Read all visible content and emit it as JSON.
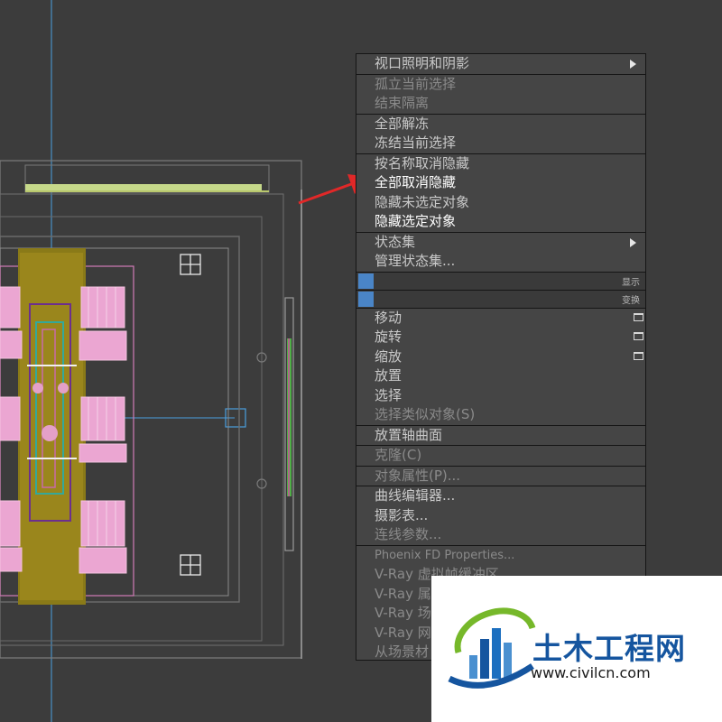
{
  "menu": {
    "sections": [
      [
        {
          "label": "视口照明和阴影",
          "submenu": true
        }
      ],
      [
        {
          "label": "孤立当前选择",
          "dim": true
        },
        {
          "label": "结束隔离",
          "dim": true
        }
      ],
      [
        {
          "label": "全部解冻"
        },
        {
          "label": "冻结当前选择"
        }
      ],
      [
        {
          "label": "按名称取消隐藏"
        },
        {
          "label": "全部取消隐藏",
          "highlight": true
        },
        {
          "label": "隐藏未选定对象"
        },
        {
          "label": "隐藏选定对象",
          "highlight": true
        }
      ],
      [
        {
          "label": "状态集",
          "submenu": true
        },
        {
          "label": "管理状态集..."
        }
      ]
    ],
    "quad_labels": {
      "display": "显示",
      "transform": "变换"
    },
    "transform_items": [
      {
        "label": "移动",
        "options": true
      },
      {
        "label": "旋转",
        "options": true
      },
      {
        "label": "缩放",
        "options": true
      },
      {
        "label": "放置"
      },
      {
        "label": "选择"
      },
      {
        "label": "选择类似对象(S)",
        "dim": true
      }
    ],
    "lower_sections": [
      [
        {
          "label": "放置轴曲面"
        }
      ],
      [
        {
          "label": "克隆(C)",
          "dim": true
        }
      ],
      [
        {
          "label": "对象属性(P)...",
          "dim": true
        }
      ],
      [
        {
          "label": "曲线编辑器..."
        },
        {
          "label": "摄影表..."
        },
        {
          "label": "连线参数...",
          "dim": true
        }
      ],
      [
        {
          "label": "Phoenix FD Properties...",
          "dim": true,
          "en": true
        },
        {
          "label": "V-Ray 虚拟帧缓冲区"
        },
        {
          "label": "V-Ray 属"
        },
        {
          "label": "V-Ray 场"
        },
        {
          "label": "V-Ray 网"
        },
        {
          "label": "从场景材"
        }
      ]
    ]
  },
  "watermark": {
    "brand": "土木工程网",
    "url": "www.civilcn.com",
    "colors": {
      "blue": "#15559f",
      "green": "#76b82a"
    }
  },
  "icons": {
    "submenu": "submenu-arrow-icon",
    "options": "options-box-icon",
    "annotation": "red-arrow-icon"
  }
}
